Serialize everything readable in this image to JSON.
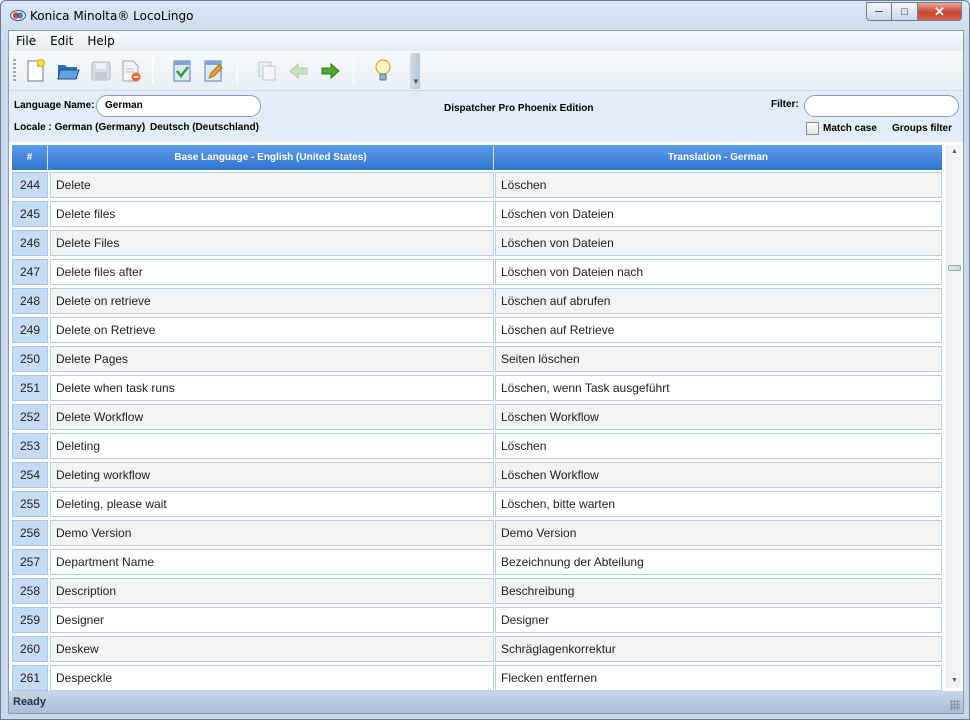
{
  "window": {
    "title": "Konica Minolta® LocoLingo",
    "controls": {
      "minimize": "─",
      "maximize": "□",
      "close": "✕"
    }
  },
  "menu": [
    "File",
    "Edit",
    "Help"
  ],
  "toolbar": {
    "buttons": [
      {
        "name": "new-file-icon",
        "enabled": true
      },
      {
        "name": "open-folder-icon",
        "enabled": true
      },
      {
        "name": "save-icon",
        "enabled": false
      },
      {
        "name": "close-file-icon",
        "enabled": true
      },
      {
        "name": "import-icon",
        "enabled": true
      },
      {
        "name": "edit-icon",
        "enabled": true
      },
      {
        "name": "copy-icon",
        "enabled": false
      },
      {
        "name": "back-arrow-icon",
        "enabled": false
      },
      {
        "name": "forward-arrow-icon",
        "enabled": true
      },
      {
        "name": "lightbulb-icon",
        "enabled": true
      }
    ]
  },
  "info": {
    "language_name_label": "Language Name:",
    "language_name_value": "German",
    "locale_label": "Locale : German (Germany)",
    "locale_native": "Deutsch (Deutschland)",
    "product": "Dispatcher Pro Phoenix Edition",
    "filter_label": "Filter:",
    "filter_value": "",
    "match_case_label": "Match case",
    "match_case_checked": false,
    "groups_filter_label": "Groups filter"
  },
  "grid": {
    "headers": {
      "num": "#",
      "base": "Base Language - English (United States)",
      "translation": "Translation - German"
    },
    "rows": [
      {
        "n": "244",
        "base": "Delete",
        "trans": "Löschen"
      },
      {
        "n": "245",
        "base": "Delete files",
        "trans": "Löschen von Dateien"
      },
      {
        "n": "246",
        "base": "Delete Files",
        "trans": "Löschen von Dateien"
      },
      {
        "n": "247",
        "base": "Delete files after",
        "trans": "Löschen von Dateien nach"
      },
      {
        "n": "248",
        "base": "Delete on retrieve",
        "trans": "Löschen auf abrufen"
      },
      {
        "n": "249",
        "base": "Delete on Retrieve",
        "trans": "Löschen auf Retrieve"
      },
      {
        "n": "250",
        "base": "Delete Pages",
        "trans": "Seiten löschen"
      },
      {
        "n": "251",
        "base": "Delete when task runs",
        "trans": "Löschen, wenn Task ausgeführt"
      },
      {
        "n": "252",
        "base": "Delete Workflow",
        "trans": "Löschen Workflow"
      },
      {
        "n": "253",
        "base": "Deleting",
        "trans": "Löschen"
      },
      {
        "n": "254",
        "base": "Deleting workflow",
        "trans": "Löschen Workflow"
      },
      {
        "n": "255",
        "base": "Deleting, please wait",
        "trans": "Löschen, bitte warten"
      },
      {
        "n": "256",
        "base": "Demo Version",
        "trans": "Demo Version"
      },
      {
        "n": "257",
        "base": "Department Name",
        "trans": "Bezeichnung der Abteilung"
      },
      {
        "n": "258",
        "base": "Description",
        "trans": "Beschreibung"
      },
      {
        "n": "259",
        "base": "Designer",
        "trans": "Designer"
      },
      {
        "n": "260",
        "base": "Deskew",
        "trans": "Schräglagenkorrektur"
      },
      {
        "n": "261",
        "base": "Despeckle",
        "trans": "Flecken entfernen"
      }
    ]
  },
  "status": "Ready",
  "colors": {
    "header_top": "#5d9ce8",
    "header_bottom": "#2f74d0",
    "row_number_bg": "#c6dcf5",
    "info_panel_bg": "#e4ecf7"
  }
}
